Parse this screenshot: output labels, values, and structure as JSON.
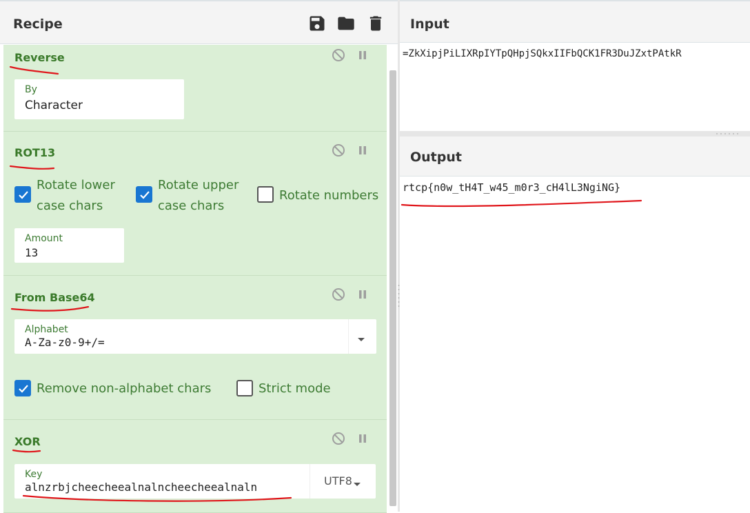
{
  "recipe": {
    "title": "Recipe",
    "operations": [
      {
        "name": "Reverse",
        "fields": [
          {
            "label": "By",
            "value": "Character"
          }
        ]
      },
      {
        "name": "ROT13",
        "checkboxes": [
          {
            "label": "Rotate lower case chars",
            "checked": true
          },
          {
            "label": "Rotate upper case chars",
            "checked": true
          },
          {
            "label": "Rotate numbers",
            "checked": false
          }
        ],
        "fields": [
          {
            "label": "Amount",
            "value": "13"
          }
        ]
      },
      {
        "name": "From Base64",
        "fields": [
          {
            "label": "Alphabet",
            "value": "A-Za-z0-9+/="
          }
        ],
        "checkboxes": [
          {
            "label": "Remove non-alphabet chars",
            "checked": true
          },
          {
            "label": "Strict mode",
            "checked": false
          }
        ]
      },
      {
        "name": "XOR",
        "fields": [
          {
            "label": "Key",
            "value": "alnzrbjcheecheealnalncheecheealnaln",
            "encoding": "UTF8"
          }
        ]
      }
    ]
  },
  "input": {
    "title": "Input",
    "text": "=ZkXipjPiLIXRpIYTpQHpjSQkxIIFbQCK1FR3DuJZxtPAtkR"
  },
  "output": {
    "title": "Output",
    "text": "rtcp{n0w_tH4T_w45_m0r3_cH4lL3NgiNG}"
  },
  "colors": {
    "operation_bg": "#dbefd6",
    "operation_title": "#3a7a2a",
    "checkbox_on": "#1976d2",
    "annotation_red": "#e0161b"
  }
}
